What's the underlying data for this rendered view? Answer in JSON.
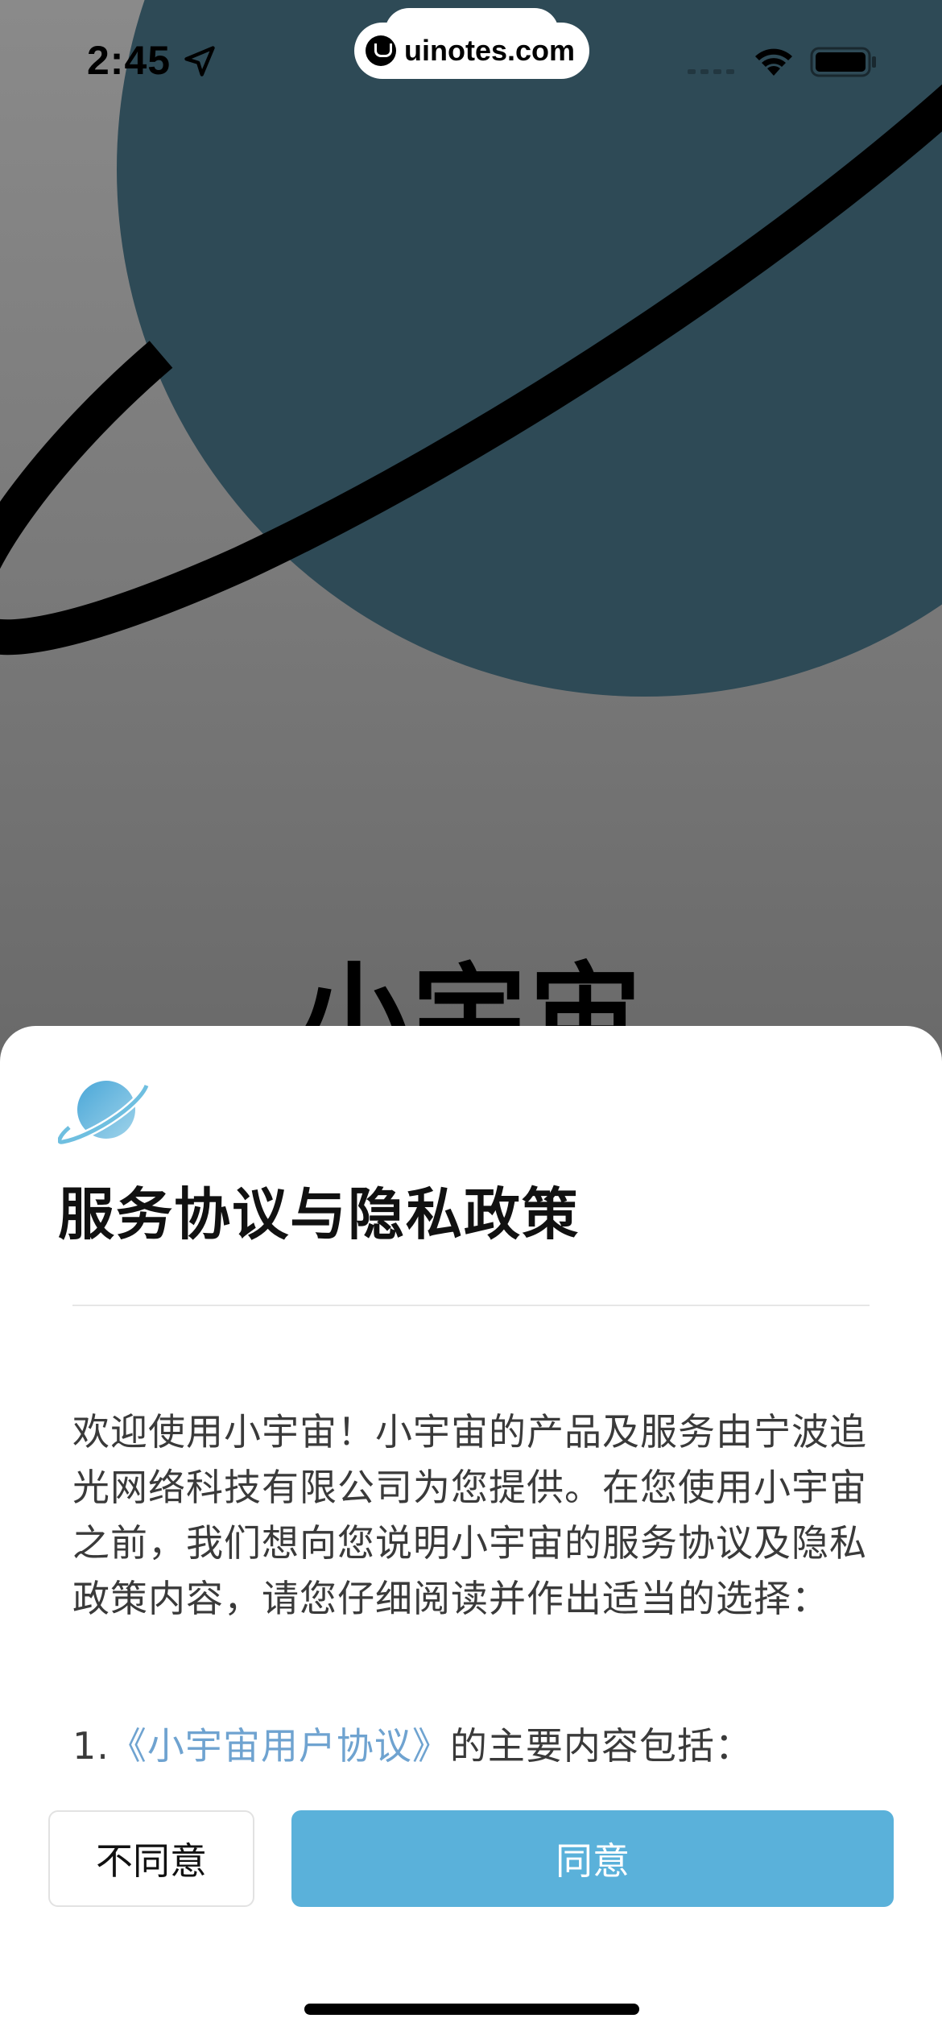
{
  "status_bar": {
    "time": "2:45",
    "watermark": "uinotes.com"
  },
  "hero": {
    "app_name": "小宇宙"
  },
  "dialog": {
    "title": "服务协议与隐私政策",
    "intro": "欢迎使用小宇宙！小宇宙的产品及服务由宁波追光网络科技有限公司为您提供。在您使用小宇宙之前，我们想向您说明小宇宙的服务协议及隐私政策内容，请您仔细阅读并作出适当的选择：",
    "item_number": "1.",
    "item_link": "《小宇宙用户协议》",
    "item_suffix": "的主要内容包括：",
    "disagree_label": "不同意",
    "agree_label": "同意"
  },
  "colors": {
    "accent": "#5ab1da",
    "link": "#6fa3d0",
    "planet": "#2e4a56"
  }
}
